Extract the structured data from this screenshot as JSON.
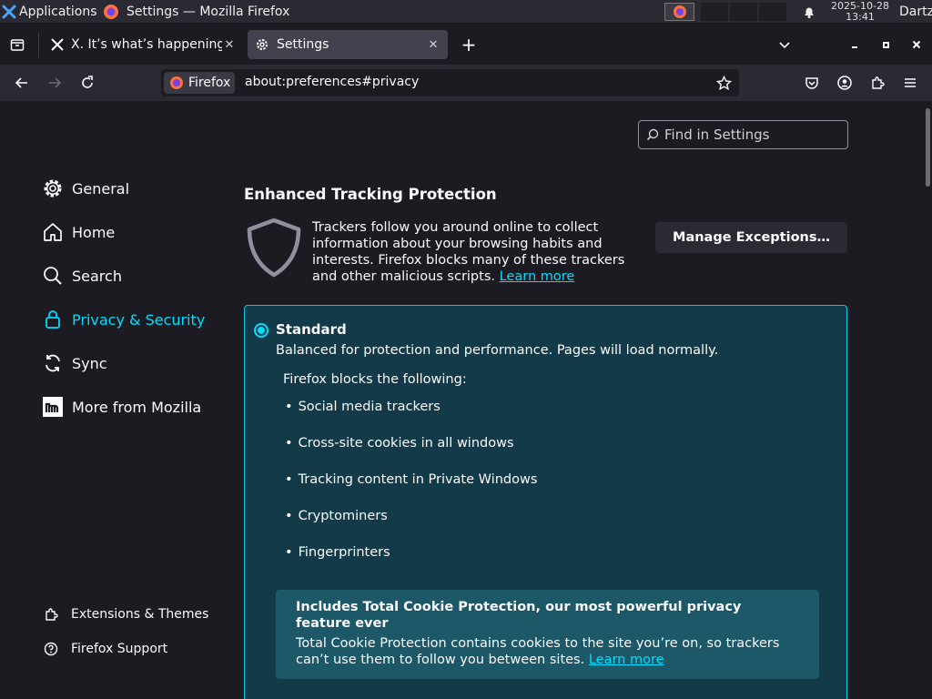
{
  "taskbar": {
    "apps_label": "Applications",
    "window_title": "Settings — Mozilla Firefox",
    "date": "2025-10-28",
    "time": "13:41",
    "user": "Dartz"
  },
  "tabs": [
    {
      "title": "X. It’s what’s happening / X",
      "icon": "x-logo-icon"
    },
    {
      "title": "Settings",
      "icon": "gear-icon"
    }
  ],
  "navbar": {
    "identity_label": "Firefox",
    "url": "about:preferences#privacy"
  },
  "search": {
    "placeholder": "Find in Settings"
  },
  "sidebar": {
    "items": [
      {
        "label": "General",
        "icon": "gear-icon"
      },
      {
        "label": "Home",
        "icon": "home-icon"
      },
      {
        "label": "Search",
        "icon": "search-icon"
      },
      {
        "label": "Privacy & Security",
        "icon": "lock-icon"
      },
      {
        "label": "Sync",
        "icon": "sync-icon"
      },
      {
        "label": "More from Mozilla",
        "icon": "mozilla-icon"
      }
    ],
    "footer": [
      {
        "label": "Extensions & Themes",
        "icon": "puzzle-icon"
      },
      {
        "label": "Firefox Support",
        "icon": "help-icon"
      }
    ]
  },
  "etp": {
    "title": "Enhanced Tracking Protection",
    "description": "Trackers follow you around online to collect information about your browsing habits and interests. Firefox blocks many of these trackers and other malicious scripts.",
    "learn_more": "Learn more",
    "manage_button": "Manage Exceptions…"
  },
  "standard": {
    "title": "Standard",
    "description": "Balanced for protection and performance. Pages will load normally.",
    "blocks_title": "Firefox blocks the following:",
    "blocks": [
      "Social media trackers",
      "Cross-site cookies in all windows",
      "Tracking content in Private Windows",
      "Cryptominers",
      "Fingerprinters"
    ],
    "tcp_title": "Includes Total Cookie Protection, our most powerful privacy feature ever",
    "tcp_description": "Total Cookie Protection contains cookies to the site you’re on, so trackers can’t use them to follow you between sites.",
    "tcp_learn_more": "Learn more"
  },
  "colors": {
    "accent": "#00ddff",
    "panel": "#123a48",
    "tcp_panel": "#1c5867"
  }
}
